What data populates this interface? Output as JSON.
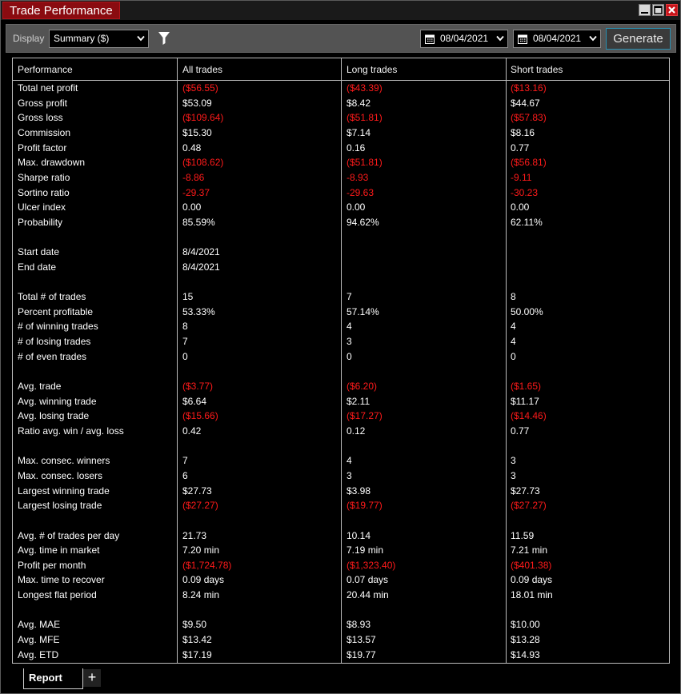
{
  "window": {
    "title": "Trade Performance"
  },
  "toolbar": {
    "display_label": "Display",
    "display_value": "Summary ($)",
    "date_from": "08/04/2021",
    "date_to": "08/04/2021",
    "generate_label": "Generate"
  },
  "columns": [
    "Performance",
    "All trades",
    "Long trades",
    "Short trades"
  ],
  "rows": [
    {
      "label": "Total net profit",
      "all": "($56.55)",
      "long": "($43.39)",
      "short": "($13.16)",
      "neg": [
        true,
        true,
        true
      ]
    },
    {
      "label": "Gross profit",
      "all": "$53.09",
      "long": "$8.42",
      "short": "$44.67",
      "neg": [
        false,
        false,
        false
      ]
    },
    {
      "label": "Gross loss",
      "all": "($109.64)",
      "long": "($51.81)",
      "short": "($57.83)",
      "neg": [
        true,
        true,
        true
      ]
    },
    {
      "label": "Commission",
      "all": "$15.30",
      "long": "$7.14",
      "short": "$8.16",
      "neg": [
        false,
        false,
        false
      ]
    },
    {
      "label": "Profit factor",
      "all": "0.48",
      "long": "0.16",
      "short": "0.77",
      "neg": [
        false,
        false,
        false
      ]
    },
    {
      "label": "Max. drawdown",
      "all": "($108.62)",
      "long": "($51.81)",
      "short": "($56.81)",
      "neg": [
        true,
        true,
        true
      ]
    },
    {
      "label": "Sharpe ratio",
      "all": "-8.86",
      "long": "-8.93",
      "short": "-9.11",
      "neg": [
        true,
        true,
        true
      ]
    },
    {
      "label": "Sortino ratio",
      "all": "-29.37",
      "long": "-29.63",
      "short": "-30.23",
      "neg": [
        true,
        true,
        true
      ]
    },
    {
      "label": "Ulcer index",
      "all": "0.00",
      "long": "0.00",
      "short": "0.00",
      "neg": [
        false,
        false,
        false
      ]
    },
    {
      "label": "Probability",
      "all": "85.59%",
      "long": "94.62%",
      "short": "62.11%",
      "neg": [
        false,
        false,
        false
      ]
    },
    {
      "label": "",
      "all": "",
      "long": "",
      "short": "",
      "neg": [
        false,
        false,
        false
      ]
    },
    {
      "label": "Start date",
      "all": "8/4/2021",
      "long": "",
      "short": "",
      "neg": [
        false,
        false,
        false
      ]
    },
    {
      "label": "End date",
      "all": "8/4/2021",
      "long": "",
      "short": "",
      "neg": [
        false,
        false,
        false
      ]
    },
    {
      "label": "",
      "all": "",
      "long": "",
      "short": "",
      "neg": [
        false,
        false,
        false
      ]
    },
    {
      "label": "Total # of trades",
      "all": "15",
      "long": "7",
      "short": "8",
      "neg": [
        false,
        false,
        false
      ]
    },
    {
      "label": "Percent profitable",
      "all": "53.33%",
      "long": "57.14%",
      "short": "50.00%",
      "neg": [
        false,
        false,
        false
      ]
    },
    {
      "label": "# of winning trades",
      "all": "8",
      "long": "4",
      "short": "4",
      "neg": [
        false,
        false,
        false
      ]
    },
    {
      "label": "# of losing trades",
      "all": "7",
      "long": "3",
      "short": "4",
      "neg": [
        false,
        false,
        false
      ]
    },
    {
      "label": "# of even trades",
      "all": "0",
      "long": "0",
      "short": "0",
      "neg": [
        false,
        false,
        false
      ]
    },
    {
      "label": "",
      "all": "",
      "long": "",
      "short": "",
      "neg": [
        false,
        false,
        false
      ]
    },
    {
      "label": "Avg. trade",
      "all": "($3.77)",
      "long": "($6.20)",
      "short": "($1.65)",
      "neg": [
        true,
        true,
        true
      ]
    },
    {
      "label": "Avg. winning trade",
      "all": "$6.64",
      "long": "$2.11",
      "short": "$11.17",
      "neg": [
        false,
        false,
        false
      ]
    },
    {
      "label": "Avg. losing trade",
      "all": "($15.66)",
      "long": "($17.27)",
      "short": "($14.46)",
      "neg": [
        true,
        true,
        true
      ]
    },
    {
      "label": "Ratio avg. win / avg. loss",
      "all": "0.42",
      "long": "0.12",
      "short": "0.77",
      "neg": [
        false,
        false,
        false
      ]
    },
    {
      "label": "",
      "all": "",
      "long": "",
      "short": "",
      "neg": [
        false,
        false,
        false
      ]
    },
    {
      "label": "Max. consec. winners",
      "all": "7",
      "long": "4",
      "short": "3",
      "neg": [
        false,
        false,
        false
      ]
    },
    {
      "label": "Max. consec. losers",
      "all": "6",
      "long": "3",
      "short": "3",
      "neg": [
        false,
        false,
        false
      ]
    },
    {
      "label": "Largest winning trade",
      "all": "$27.73",
      "long": "$3.98",
      "short": "$27.73",
      "neg": [
        false,
        false,
        false
      ]
    },
    {
      "label": "Largest losing trade",
      "all": "($27.27)",
      "long": "($19.77)",
      "short": "($27.27)",
      "neg": [
        true,
        true,
        true
      ]
    },
    {
      "label": "",
      "all": "",
      "long": "",
      "short": "",
      "neg": [
        false,
        false,
        false
      ]
    },
    {
      "label": "Avg. # of trades per day",
      "all": "21.73",
      "long": "10.14",
      "short": "11.59",
      "neg": [
        false,
        false,
        false
      ]
    },
    {
      "label": "Avg. time in market",
      "all": "7.20 min",
      "long": "7.19 min",
      "short": "7.21 min",
      "neg": [
        false,
        false,
        false
      ]
    },
    {
      "label": "Profit per month",
      "all": "($1,724.78)",
      "long": "($1,323.40)",
      "short": "($401.38)",
      "neg": [
        true,
        true,
        true
      ]
    },
    {
      "label": "Max. time to recover",
      "all": "0.09 days",
      "long": "0.07 days",
      "short": "0.09 days",
      "neg": [
        false,
        false,
        false
      ]
    },
    {
      "label": "Longest flat period",
      "all": "8.24 min",
      "long": "20.44 min",
      "short": "18.01 min",
      "neg": [
        false,
        false,
        false
      ]
    },
    {
      "label": "",
      "all": "",
      "long": "",
      "short": "",
      "neg": [
        false,
        false,
        false
      ]
    },
    {
      "label": "Avg. MAE",
      "all": "$9.50",
      "long": "$8.93",
      "short": "$10.00",
      "neg": [
        false,
        false,
        false
      ]
    },
    {
      "label": "Avg. MFE",
      "all": "$13.42",
      "long": "$13.57",
      "short": "$13.28",
      "neg": [
        false,
        false,
        false
      ]
    },
    {
      "label": "Avg. ETD",
      "all": "$17.19",
      "long": "$19.77",
      "short": "$14.93",
      "neg": [
        false,
        false,
        false
      ]
    }
  ],
  "tabs": {
    "report": "Report",
    "add": "+"
  },
  "colors": {
    "negative": "#ff1a1a",
    "title_bg": "#8a0b10",
    "accent": "#2a8fb0"
  },
  "icons": {
    "minimize": "minimize-icon",
    "maximize": "maximize-icon",
    "close": "close-icon",
    "filter": "filter-icon",
    "calendar": "calendar-icon",
    "dropdown": "chevron-down-icon"
  }
}
